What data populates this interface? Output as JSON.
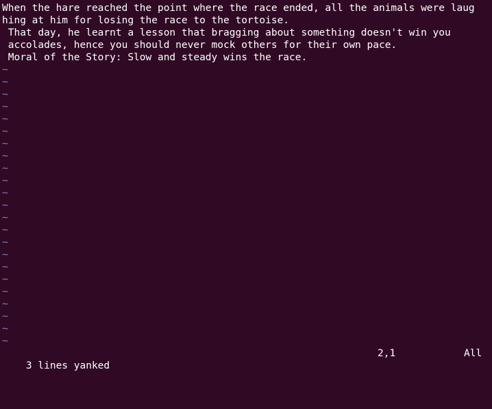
{
  "editor": {
    "lines": [
      "When the hare reached the point where the race ended, all the animals were laug",
      "hing at him for losing the race to the tortoise.",
      " That day, he learnt a lesson that bragging about something doesn't win you",
      " accolades, hence you should never mock others for their own pace.",
      " Moral of the Story: Slow and steady wins the race."
    ],
    "empty_line_marker": "~",
    "empty_line_count": 23
  },
  "status_line": {
    "message": "3 lines yanked",
    "cursor_position": "2,1",
    "scroll_percent": "All"
  },
  "colors": {
    "background": "#300a24",
    "text": "#ffffff",
    "tilde": "#8080c0"
  }
}
